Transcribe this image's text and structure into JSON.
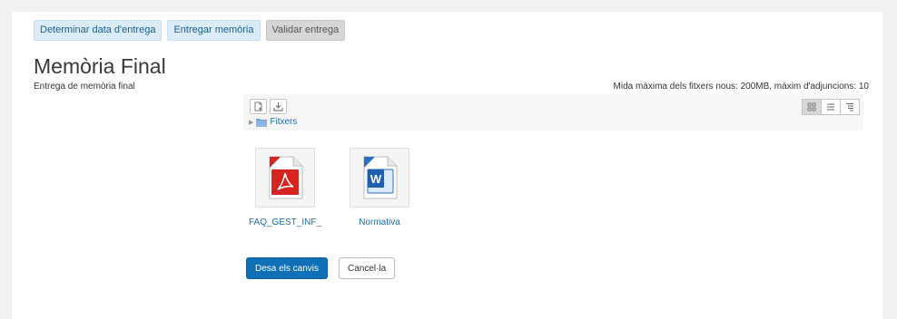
{
  "tabs": [
    {
      "label": "Determinar data d'entrega",
      "active": false
    },
    {
      "label": "Entregar memòria",
      "active": false
    },
    {
      "label": "Validar entrega",
      "active": true
    }
  ],
  "section": {
    "title": "Memòria Final",
    "description": "Entrega de memòria final",
    "limits": "Mida màxima dels fitxers nous: 200MB, màxim d'adjuncions: 10"
  },
  "filemanager": {
    "toolbar": {
      "add_icon": "add-file-icon",
      "download_icon": "download-icon",
      "views": [
        "icons-view-icon",
        "list-view-icon",
        "tree-view-icon"
      ],
      "selected_view": "icons-view-icon"
    },
    "breadcrumb": {
      "label": "Fitxers",
      "icon": "folder-icon"
    },
    "files": [
      {
        "name": "FAQ_GEST_INF_",
        "type": "pdf",
        "icon": "pdf-file-icon"
      },
      {
        "name": "Normativa",
        "type": "docx",
        "icon": "word-file-icon"
      }
    ]
  },
  "actions": {
    "save_label": "Desa els canvis",
    "cancel_label": "Cancel·la"
  },
  "colors": {
    "primary": "#0f70b7",
    "tab_bg": "#d9ecf7",
    "tab_active_bg": "#d6d6d6",
    "link": "#1d6fa5"
  }
}
